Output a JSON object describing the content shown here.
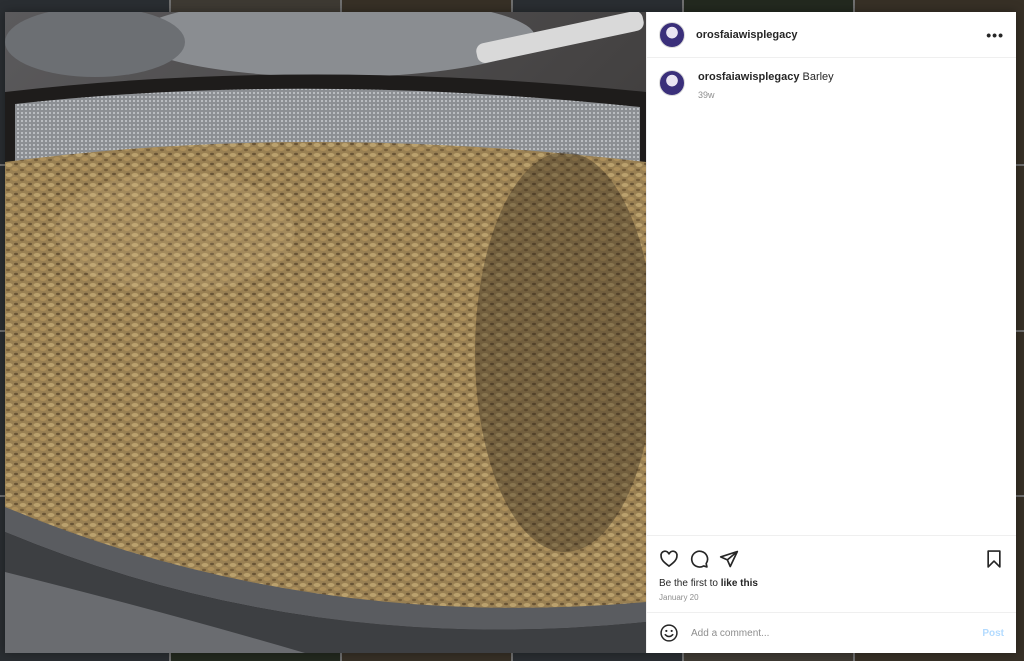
{
  "post": {
    "username": "orosfaiawisplegacy",
    "more_label": "•••",
    "photo_icon": "barley-photo",
    "caption": {
      "username": "orosfaiawisplegacy",
      "text": "Barley",
      "time_ago": "39w"
    },
    "likes": {
      "prefix": "Be the first to ",
      "link": "like this"
    },
    "date": "January 20"
  },
  "comment": {
    "placeholder": "Add a comment...",
    "post_label": "Post"
  },
  "icons": {
    "like": "heart-icon",
    "comment": "comment-bubble-icon",
    "share": "paper-plane-icon",
    "save": "bookmark-icon",
    "emoji": "smiley-icon"
  },
  "colors": {
    "post_button": "#b3dbff",
    "secondary_text": "#8e8e8e",
    "primary_text": "#262626"
  }
}
